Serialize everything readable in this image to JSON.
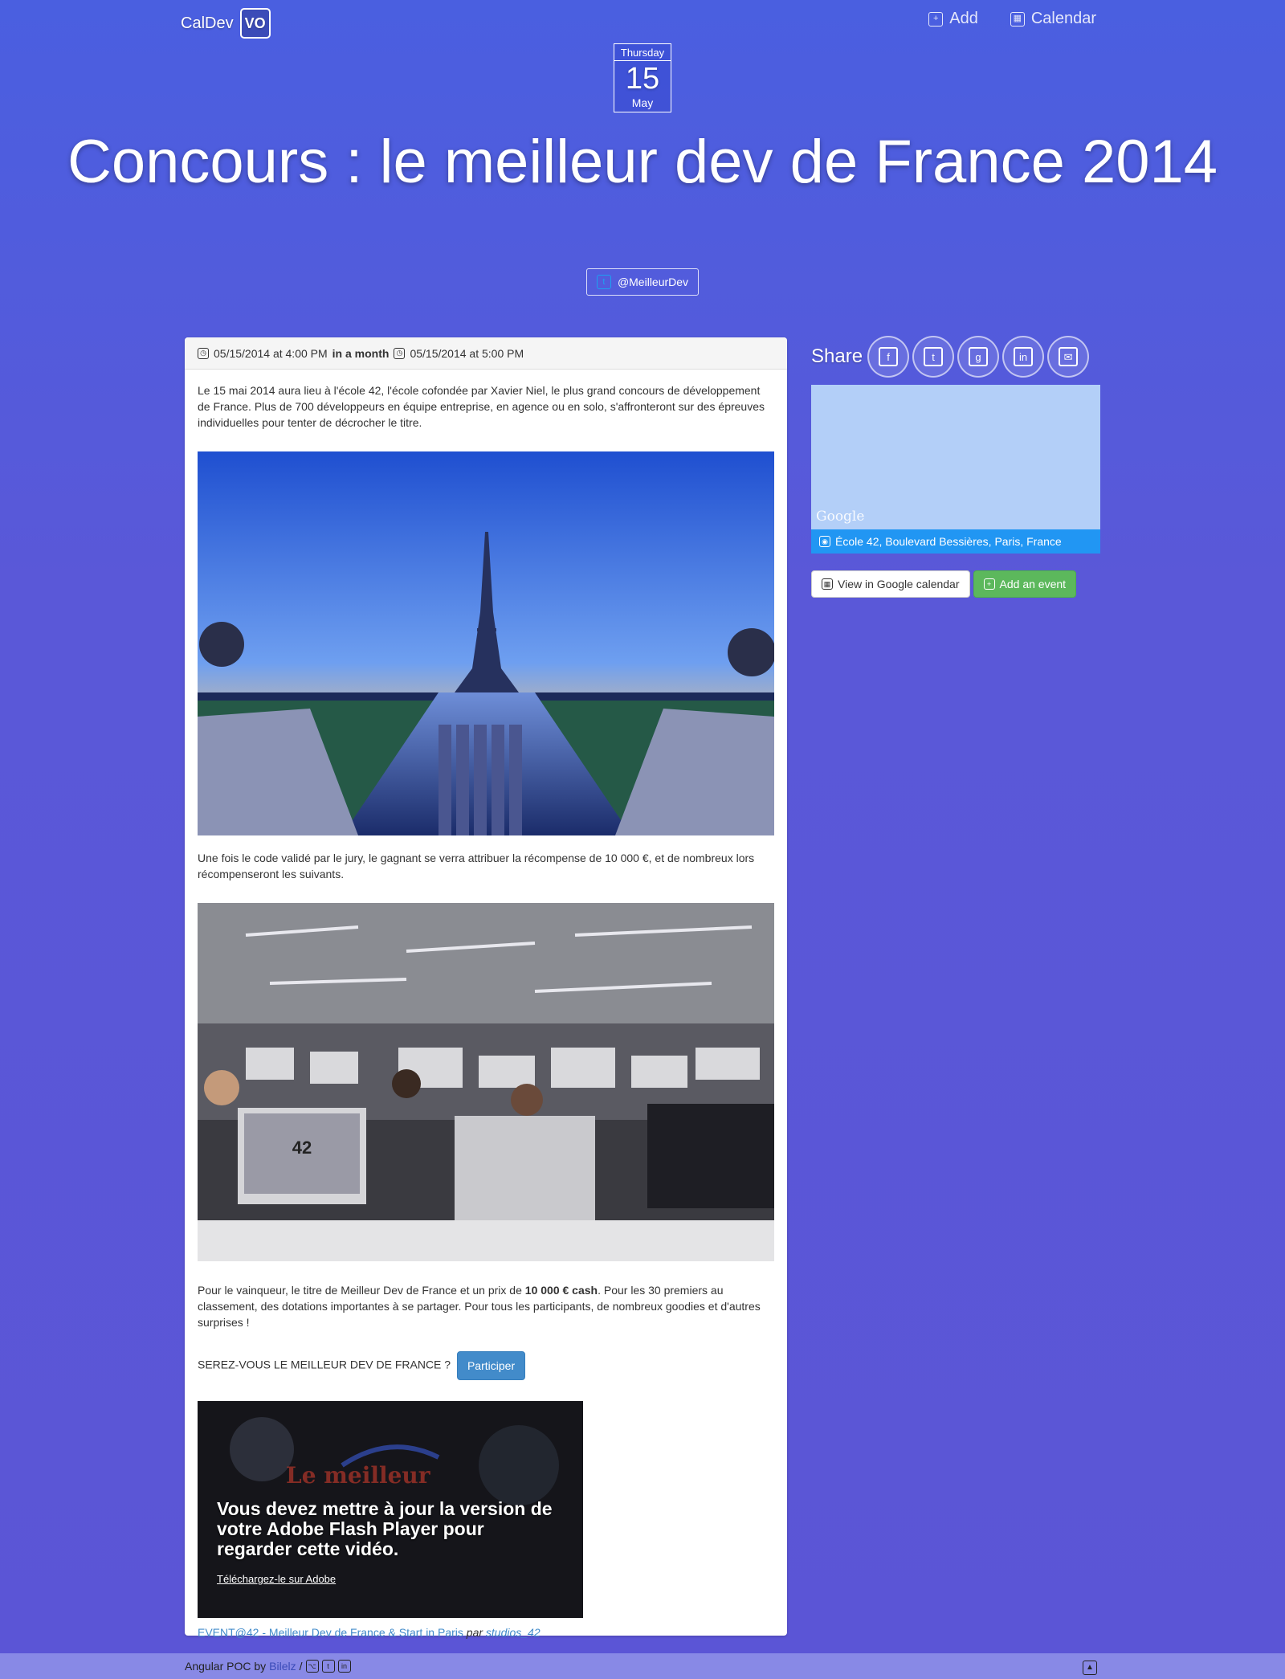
{
  "nav": {
    "brand": "CalDev",
    "logo_text": "VO",
    "links": [
      {
        "label": "Add",
        "icon": "plus-icon"
      },
      {
        "label": "Calendar",
        "icon": "calendar-icon"
      }
    ]
  },
  "date_badge": {
    "weekday": "Thursday",
    "day": "15",
    "month": "May"
  },
  "event": {
    "title": "Concours : le meilleur dev de France 2014",
    "twitter": "@MeilleurDev",
    "start": "05/15/2014 at 4:00 PM",
    "relative": "in a month",
    "end": "05/15/2014 at 5:00 PM",
    "para1": "Le 15 mai 2014 aura lieu à l'école 42, l'école cofondée par Xavier Niel, le plus grand concours de développement de France. Plus de 700 développeurs en équipe entreprise, en agence ou en solo, s'affronteront sur des épreuves individuelles pour tenter de décrocher le titre.",
    "para2": "Une fois le code validé par le jury, le gagnant se verra attribuer la récompense de 10 000 €, et de nombreux lors récompenseront les suivants.",
    "para3_a": "Pour le vainqueur, le titre de Meilleur Dev de France et un prix de ",
    "para3_b": "10 000 € cash",
    "para3_c": ". Pour les 30 premiers au classement, des dotations importantes à se partager. Pour tous les participants, de nombreux goodies et d'autres surprises !",
    "question": "SEREZ-VOUS LE MEILLEUR DEV DE FRANCE ?",
    "cta": "Participer",
    "photo2_text": "42",
    "video_overlay_big": "Le meilleur",
    "video_msg": "Vous devez mettre à jour la version de votre Adobe Flash Player pour regarder cette vidéo.",
    "video_link": "Téléchargez-le sur Adobe",
    "caption_link": "EVENT@42 - Meilleur Dev de France & Start in Paris",
    "caption_par": "par",
    "caption_author": "studios_42"
  },
  "sidebar": {
    "share_label": "Share",
    "share_icons": [
      "facebook-icon",
      "twitter-icon",
      "google-plus-icon",
      "linkedin-icon",
      "email-icon"
    ],
    "map_watermark": "Google",
    "address": "École 42, Boulevard Bessières, Paris, France",
    "btn_google": "View in Google calendar",
    "btn_add": "Add an event"
  },
  "footer": {
    "text": "Angular POC by",
    "author": "Bilelz",
    "sep": "/"
  },
  "colors": {
    "accent": "#428bca",
    "success": "#5cb85c",
    "map": "#b3cff8",
    "address_bar": "#2196f3"
  }
}
